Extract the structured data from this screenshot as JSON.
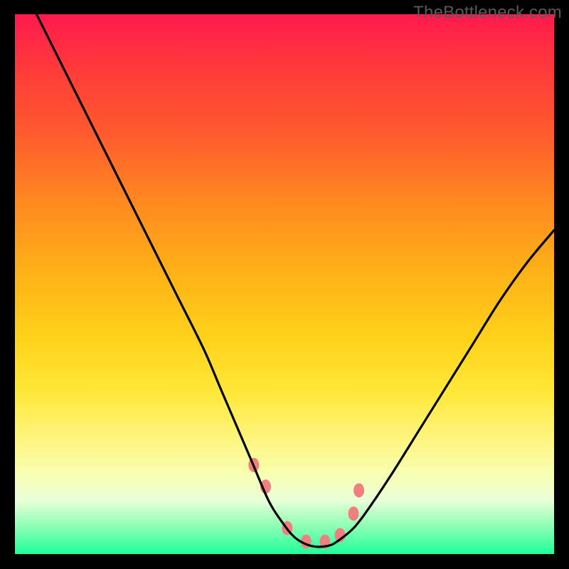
{
  "watermark": "TheBottleneck.com",
  "chart_data": {
    "type": "line",
    "title": "",
    "xlabel": "",
    "ylabel": "",
    "xlim": [
      0,
      100
    ],
    "ylim": [
      0,
      100
    ],
    "series": [
      {
        "name": "bottleneck-curve",
        "x": [
          4,
          10,
          15,
          20,
          25,
          30,
          35,
          38,
          41,
          44,
          47,
          49.5,
          52,
          55,
          58,
          60,
          63,
          66,
          70,
          75,
          80,
          85,
          90,
          95,
          100
        ],
        "y": [
          100,
          88,
          78,
          68,
          58,
          48,
          38,
          31,
          24,
          17,
          10,
          6,
          3,
          1.5,
          1.5,
          2.5,
          5,
          9,
          15,
          23,
          31,
          39,
          47,
          54,
          60
        ]
      }
    ],
    "markers": {
      "name": "highlight-points",
      "x": [
        44.3,
        46.5,
        50.5,
        54,
        57.5,
        60.3,
        62.8,
        63.8
      ],
      "y": [
        16.5,
        12.5,
        4.8,
        2.3,
        2.3,
        3.5,
        7.5,
        11.8
      ]
    },
    "marker_style": {
      "fill": "#f08080",
      "rx": 7.5,
      "ry": 10
    },
    "gradient_stops": [
      {
        "pos": 0,
        "color": "#ff1a4d"
      },
      {
        "pos": 35,
        "color": "#ff8a1f"
      },
      {
        "pos": 60,
        "color": "#ffd21a"
      },
      {
        "pos": 85,
        "color": "#f8ffb0"
      },
      {
        "pos": 100,
        "color": "#1fff9a"
      }
    ]
  }
}
